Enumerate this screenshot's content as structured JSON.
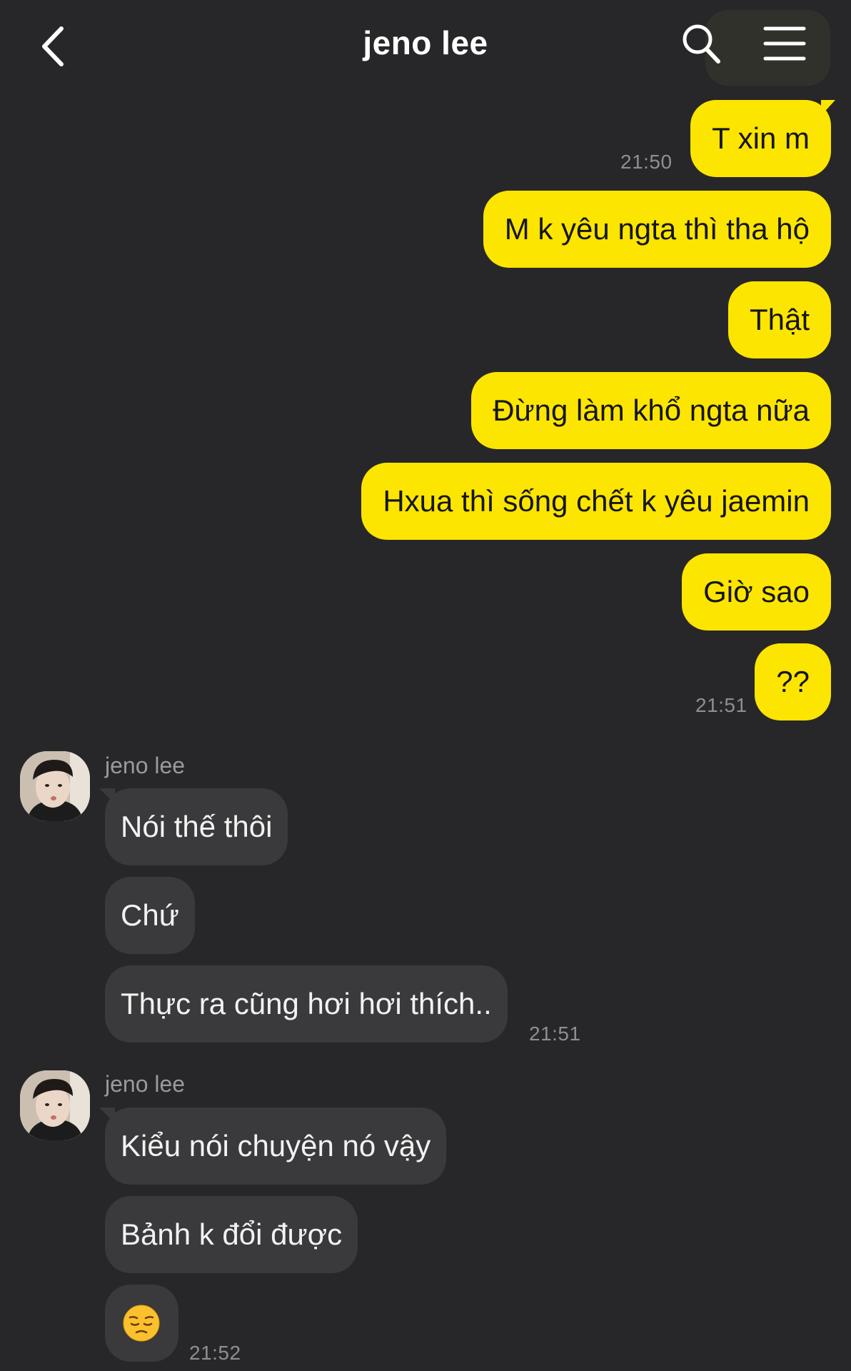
{
  "header": {
    "title": "jeno lee"
  },
  "colors": {
    "background": "#272729",
    "outgoing_bubble": "#fce500",
    "incoming_bubble": "#3a3a3c"
  },
  "icons": {
    "back": "chevron-left-icon",
    "search": "search-icon",
    "menu": "hamburger-menu-icon"
  },
  "outgoing": {
    "messages": [
      "T xin m",
      "M k yêu ngta thì tha hộ",
      "Thật",
      "Đừng làm khổ ngta nữa",
      "Hxua thì sống chết k yêu jaemin",
      "Giờ sao",
      "??"
    ],
    "time_1": "21:50",
    "time_2": "21:51"
  },
  "incoming_group_1": {
    "sender": "jeno lee",
    "messages": [
      "Nói thế thôi",
      "Chứ",
      "Thực ra cũng hơi hơi thích.."
    ],
    "time": "21:51"
  },
  "incoming_group_2": {
    "sender": "jeno lee",
    "messages": [
      "Kiểu nói chuyện nó vậy",
      "Bảnh k đổi được"
    ],
    "emoji": "pensive-face",
    "time": "21:52"
  }
}
